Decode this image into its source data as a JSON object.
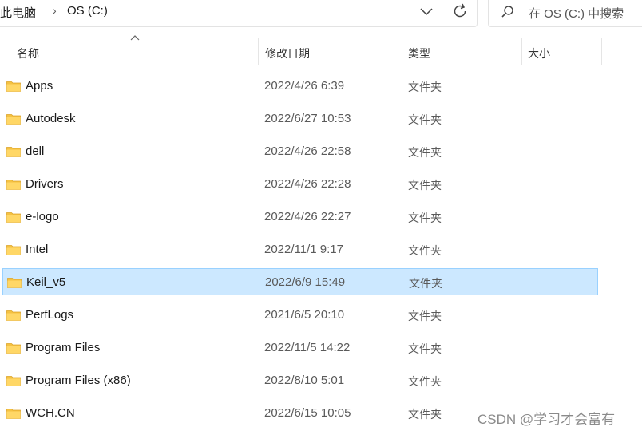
{
  "breadcrumb": {
    "root": "此电脑",
    "drive": "OS (C:)"
  },
  "search": {
    "placeholder": "在 OS (C:) 中搜索"
  },
  "columns": {
    "name": "名称",
    "date": "修改日期",
    "type": "类型",
    "size": "大小"
  },
  "files": [
    {
      "name": "Apps",
      "date": "2022/4/26 6:39",
      "type": "文件夹"
    },
    {
      "name": "Autodesk",
      "date": "2022/6/27 10:53",
      "type": "文件夹"
    },
    {
      "name": "dell",
      "date": "2022/4/26 22:58",
      "type": "文件夹"
    },
    {
      "name": "Drivers",
      "date": "2022/4/26 22:28",
      "type": "文件夹"
    },
    {
      "name": "e-logo",
      "date": "2022/4/26 22:27",
      "type": "文件夹"
    },
    {
      "name": "Intel",
      "date": "2022/11/1 9:17",
      "type": "文件夹"
    },
    {
      "name": "Keil_v5",
      "date": "2022/6/9 15:49",
      "type": "文件夹",
      "selected": true
    },
    {
      "name": "PerfLogs",
      "date": "2021/6/5 20:10",
      "type": "文件夹"
    },
    {
      "name": "Program Files",
      "date": "2022/11/5 14:22",
      "type": "文件夹"
    },
    {
      "name": "Program Files (x86)",
      "date": "2022/8/10 5:01",
      "type": "文件夹"
    },
    {
      "name": "WCH.CN",
      "date": "2022/6/15 10:05",
      "type": "文件夹"
    }
  ],
  "watermark": "CSDN @学习才会富有",
  "colors": {
    "selection_bg": "#cce8ff",
    "selection_border": "#99d1ff",
    "folder": "#f5c242"
  }
}
